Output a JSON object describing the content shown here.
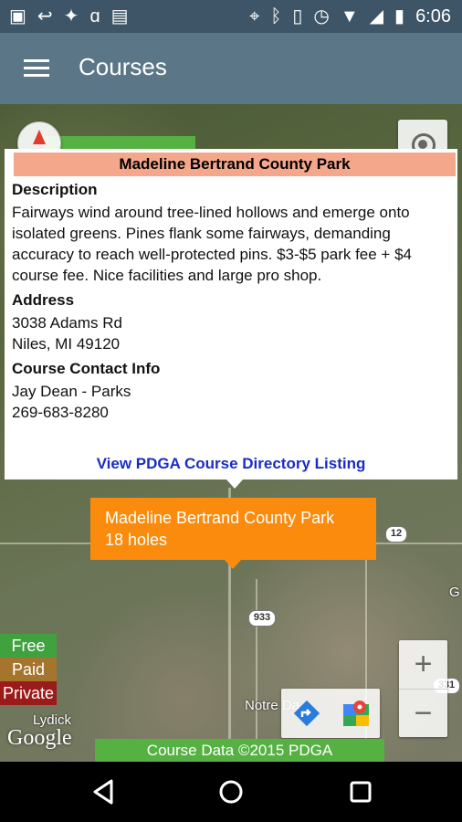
{
  "status_bar": {
    "time": "6:06",
    "left_icons": [
      "image-icon",
      "missed-call-icon",
      "twitter-icon",
      "amazon-icon",
      "briefcase-icon"
    ],
    "right_icons": [
      "location-icon",
      "bluetooth-icon",
      "vibrate-icon",
      "alarm-icon",
      "wifi-icon",
      "signal-icon",
      "battery-icon"
    ]
  },
  "app_bar": {
    "title": "Courses"
  },
  "info_window": {
    "title": "Madeline Bertrand County Park",
    "sections": [
      {
        "heading": "Description",
        "lines": [
          "Fairways wind around tree-lined hollows and emerge onto isolated greens. Pines flank some fairways, demanding accuracy to reach well-protected pins. $3-$5 park fee + $4 course fee. Nice facilities and large pro shop."
        ]
      },
      {
        "heading": "Address",
        "lines": [
          "3038 Adams Rd",
          "Niles, MI 49120"
        ]
      },
      {
        "heading": "Course Contact Info",
        "lines": [
          "Jay Dean - Parks",
          "269-683-8280"
        ]
      }
    ],
    "link": "View PDGA Course Directory Listing"
  },
  "marker": {
    "name": "Madeline Bertrand County Park",
    "holes": "18 holes"
  },
  "legend": {
    "free": "Free",
    "paid": "Paid",
    "private": "Private"
  },
  "map_labels": {
    "lydick": "Lydick",
    "notre_dame": "Notre Da",
    "route_933": "933",
    "route_12": "12",
    "route_331": "331",
    "edge_g": "G",
    "google": "Google"
  },
  "footer": {
    "credit": "Course Data ©2015 PDGA"
  },
  "colors": {
    "status_bar": "#3d5566",
    "app_bar": "#5a7687",
    "marker": "#fb8b0c",
    "info_header": "#f5a78c",
    "link": "#1a2dc4",
    "free": "#3fa23f",
    "paid": "#a5752e",
    "private": "#9b1a1a"
  }
}
